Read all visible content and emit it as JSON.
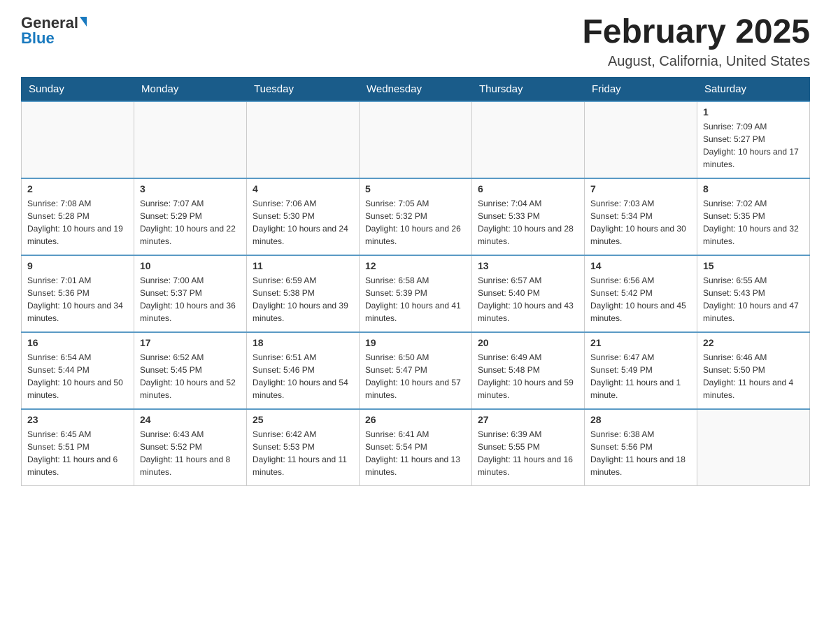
{
  "logo": {
    "general": "General",
    "blue": "Blue"
  },
  "header": {
    "month_year": "February 2025",
    "location": "August, California, United States"
  },
  "days_of_week": [
    "Sunday",
    "Monday",
    "Tuesday",
    "Wednesday",
    "Thursday",
    "Friday",
    "Saturday"
  ],
  "weeks": [
    [
      {
        "day": "",
        "info": ""
      },
      {
        "day": "",
        "info": ""
      },
      {
        "day": "",
        "info": ""
      },
      {
        "day": "",
        "info": ""
      },
      {
        "day": "",
        "info": ""
      },
      {
        "day": "",
        "info": ""
      },
      {
        "day": "1",
        "info": "Sunrise: 7:09 AM\nSunset: 5:27 PM\nDaylight: 10 hours and 17 minutes."
      }
    ],
    [
      {
        "day": "2",
        "info": "Sunrise: 7:08 AM\nSunset: 5:28 PM\nDaylight: 10 hours and 19 minutes."
      },
      {
        "day": "3",
        "info": "Sunrise: 7:07 AM\nSunset: 5:29 PM\nDaylight: 10 hours and 22 minutes."
      },
      {
        "day": "4",
        "info": "Sunrise: 7:06 AM\nSunset: 5:30 PM\nDaylight: 10 hours and 24 minutes."
      },
      {
        "day": "5",
        "info": "Sunrise: 7:05 AM\nSunset: 5:32 PM\nDaylight: 10 hours and 26 minutes."
      },
      {
        "day": "6",
        "info": "Sunrise: 7:04 AM\nSunset: 5:33 PM\nDaylight: 10 hours and 28 minutes."
      },
      {
        "day": "7",
        "info": "Sunrise: 7:03 AM\nSunset: 5:34 PM\nDaylight: 10 hours and 30 minutes."
      },
      {
        "day": "8",
        "info": "Sunrise: 7:02 AM\nSunset: 5:35 PM\nDaylight: 10 hours and 32 minutes."
      }
    ],
    [
      {
        "day": "9",
        "info": "Sunrise: 7:01 AM\nSunset: 5:36 PM\nDaylight: 10 hours and 34 minutes."
      },
      {
        "day": "10",
        "info": "Sunrise: 7:00 AM\nSunset: 5:37 PM\nDaylight: 10 hours and 36 minutes."
      },
      {
        "day": "11",
        "info": "Sunrise: 6:59 AM\nSunset: 5:38 PM\nDaylight: 10 hours and 39 minutes."
      },
      {
        "day": "12",
        "info": "Sunrise: 6:58 AM\nSunset: 5:39 PM\nDaylight: 10 hours and 41 minutes."
      },
      {
        "day": "13",
        "info": "Sunrise: 6:57 AM\nSunset: 5:40 PM\nDaylight: 10 hours and 43 minutes."
      },
      {
        "day": "14",
        "info": "Sunrise: 6:56 AM\nSunset: 5:42 PM\nDaylight: 10 hours and 45 minutes."
      },
      {
        "day": "15",
        "info": "Sunrise: 6:55 AM\nSunset: 5:43 PM\nDaylight: 10 hours and 47 minutes."
      }
    ],
    [
      {
        "day": "16",
        "info": "Sunrise: 6:54 AM\nSunset: 5:44 PM\nDaylight: 10 hours and 50 minutes."
      },
      {
        "day": "17",
        "info": "Sunrise: 6:52 AM\nSunset: 5:45 PM\nDaylight: 10 hours and 52 minutes."
      },
      {
        "day": "18",
        "info": "Sunrise: 6:51 AM\nSunset: 5:46 PM\nDaylight: 10 hours and 54 minutes."
      },
      {
        "day": "19",
        "info": "Sunrise: 6:50 AM\nSunset: 5:47 PM\nDaylight: 10 hours and 57 minutes."
      },
      {
        "day": "20",
        "info": "Sunrise: 6:49 AM\nSunset: 5:48 PM\nDaylight: 10 hours and 59 minutes."
      },
      {
        "day": "21",
        "info": "Sunrise: 6:47 AM\nSunset: 5:49 PM\nDaylight: 11 hours and 1 minute."
      },
      {
        "day": "22",
        "info": "Sunrise: 6:46 AM\nSunset: 5:50 PM\nDaylight: 11 hours and 4 minutes."
      }
    ],
    [
      {
        "day": "23",
        "info": "Sunrise: 6:45 AM\nSunset: 5:51 PM\nDaylight: 11 hours and 6 minutes."
      },
      {
        "day": "24",
        "info": "Sunrise: 6:43 AM\nSunset: 5:52 PM\nDaylight: 11 hours and 8 minutes."
      },
      {
        "day": "25",
        "info": "Sunrise: 6:42 AM\nSunset: 5:53 PM\nDaylight: 11 hours and 11 minutes."
      },
      {
        "day": "26",
        "info": "Sunrise: 6:41 AM\nSunset: 5:54 PM\nDaylight: 11 hours and 13 minutes."
      },
      {
        "day": "27",
        "info": "Sunrise: 6:39 AM\nSunset: 5:55 PM\nDaylight: 11 hours and 16 minutes."
      },
      {
        "day": "28",
        "info": "Sunrise: 6:38 AM\nSunset: 5:56 PM\nDaylight: 11 hours and 18 minutes."
      },
      {
        "day": "",
        "info": ""
      }
    ]
  ]
}
